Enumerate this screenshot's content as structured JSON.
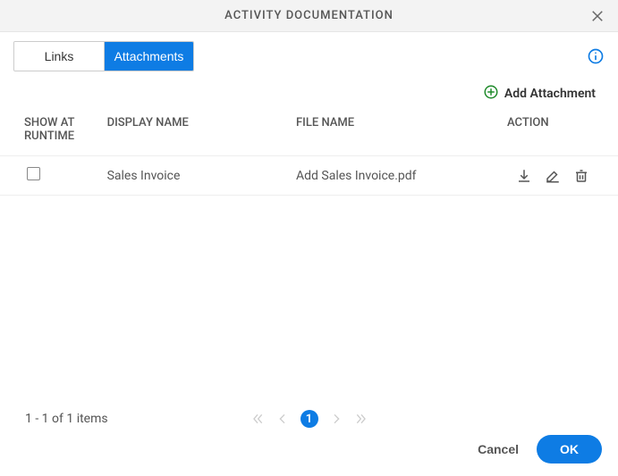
{
  "header": {
    "title": "ACTIVITY DOCUMENTATION"
  },
  "tabs": {
    "items": [
      {
        "label": "Links",
        "active": false
      },
      {
        "label": "Attachments",
        "active": true
      }
    ]
  },
  "toolbar": {
    "add_attachment": "Add Attachment"
  },
  "table": {
    "columns": {
      "show_at_runtime_line1": "SHOW AT",
      "show_at_runtime_line2": "RUNTIME",
      "display_name": "DISPLAY NAME",
      "file_name": "FILE NAME",
      "action": "ACTION"
    },
    "rows": [
      {
        "show_at_runtime": false,
        "display_name": "Sales Invoice",
        "file_name": "Add Sales Invoice.pdf"
      }
    ]
  },
  "pagination": {
    "info": "1 - 1 of 1 items",
    "current_page": "1"
  },
  "footer": {
    "cancel": "Cancel",
    "ok": "OK"
  },
  "colors": {
    "primary": "#0e7ce4",
    "text_muted": "#555",
    "success": "#1f8a2a"
  }
}
